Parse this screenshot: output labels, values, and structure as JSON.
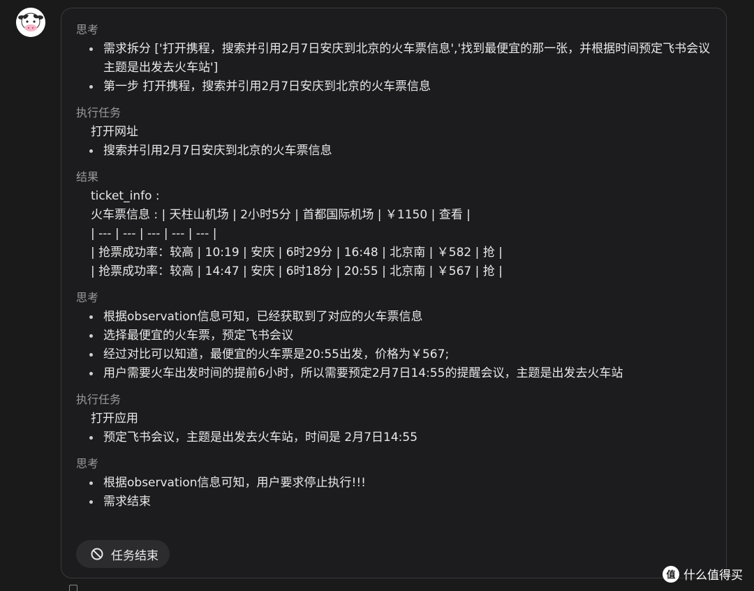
{
  "sections": [
    {
      "label": "思考",
      "bullets": [
        "需求拆分 ['打开携程，搜索并引用2月7日安庆到北京的火车票信息','找到最便宜的那一张，并根据时间预定飞书会议  主题是出发去火车站']",
        "第一步 打开携程，搜索并引用2月7日安庆到北京的火车票信息"
      ]
    },
    {
      "label": "执行任务",
      "plain": "打开网址",
      "bullets": [
        "搜索并引用2月7日安庆到北京的火车票信息"
      ]
    },
    {
      "label": "结果",
      "lines": [
        "ticket_info :",
        "火车票信息 : | 天柱山机场 | 2小时5分 | 首都国际机场 | ￥1150 | 查看 |",
        "| --- | --- | --- | --- | --- |",
        "| 抢票成功率：较高 | 10:19 | 安庆 | 6时29分 | 16:48 | 北京南 | ￥582 | 抢 |",
        "| 抢票成功率：较高 | 14:47 | 安庆 | 6时18分 | 20:55 | 北京南 | ￥567 | 抢 |"
      ]
    },
    {
      "label": "思考",
      "bullets": [
        "根据observation信息可知，已经获取到了对应的火车票信息",
        "选择最便宜的火车票，预定飞书会议",
        "经过对比可以知道，最便宜的火车票是20:55出发，价格为￥567;",
        "用户需要火车出发时间的提前6小时，所以需要预定2月7日14:55的提醒会议，主题是出发去火车站"
      ]
    },
    {
      "label": "执行任务",
      "plain": "打开应用",
      "bullets": [
        "预定飞书会议，主题是出发去火车站，时间是 2月7日14:55"
      ]
    },
    {
      "label": "思考",
      "bullets": [
        "根据observation信息可知，用户要求停止执行!!!",
        "需求结束"
      ]
    }
  ],
  "end_button": {
    "label": "任务结束",
    "icon": "ban-icon"
  },
  "watermark": {
    "logo_text": "值",
    "text": "什么值得买"
  },
  "avatar": {
    "icon": "cow-icon"
  }
}
